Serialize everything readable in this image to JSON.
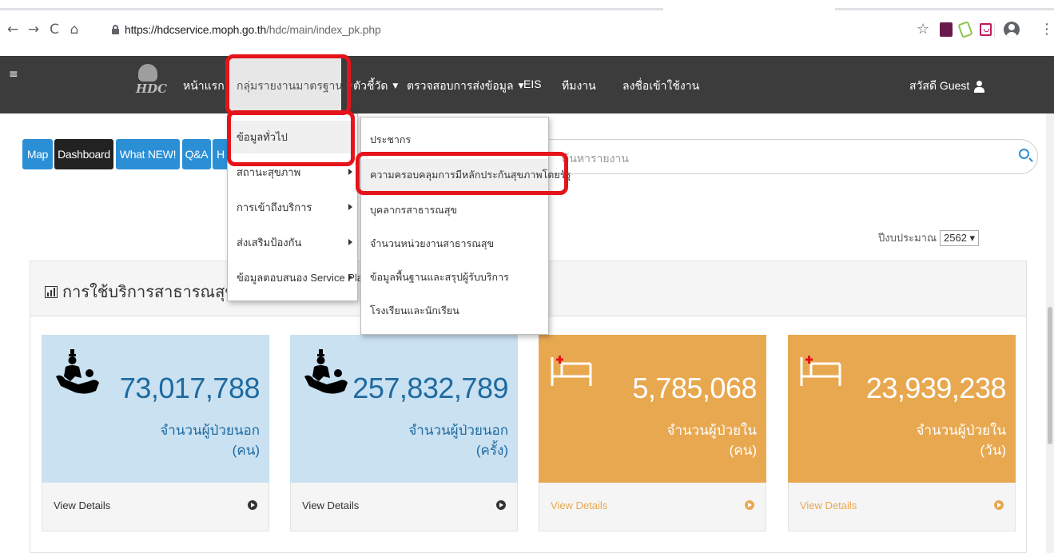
{
  "browser": {
    "url_host": "https://hdcservice.moph.go.th",
    "url_path": "/hdc/main/index_pk.php"
  },
  "navbar": {
    "home": "หน้าแรก",
    "standard_reports": "กลุ่มรายงานมาตรฐาน",
    "indicators": "ตัวชี้วัด",
    "data_check": "ตรวจสอบการส่งข้อมูล",
    "eis": "EIS",
    "team": "ทีมงาน",
    "register": "ลงชื่อเข้าใช้งาน",
    "greeting": "สวัสดี Guest"
  },
  "pills": [
    "Map",
    "Dashboard",
    "What NEW!",
    "Q&A",
    "H"
  ],
  "search": {
    "placeholder": "ค้นหารายงาน"
  },
  "fiscal_year": {
    "label": "ปีงบประมาณ",
    "value": "2562 ▾"
  },
  "panel": {
    "title": "การใช้บริการสาธารณสุข"
  },
  "menu1": {
    "items": [
      {
        "label": "ข้อมูลทั่วไป",
        "submenu": false
      },
      {
        "label": "สถานะสุขภาพ",
        "submenu": true
      },
      {
        "label": "การเข้าถึงบริการ",
        "submenu": true
      },
      {
        "label": "ส่งเสริมป้องกัน",
        "submenu": true
      },
      {
        "label": "ข้อมูลตอบสนอง Service Plan",
        "submenu": true
      }
    ]
  },
  "menu2": {
    "items": [
      {
        "label": "ประชากร"
      },
      {
        "label": "ความครอบคลุมการมีหลักประกันสุขภาพโดยรัฐ"
      },
      {
        "label": "บุคลากรสาธารณสุข"
      },
      {
        "label": "จำนวนหน่วยงานสาธารณสุข"
      },
      {
        "label": "ข้อมูลพื้นฐานและสรุปผู้รับบริการ"
      },
      {
        "label": "โรงเรียนและนักเรียน"
      }
    ]
  },
  "cards": [
    {
      "value": "73,017,788",
      "label1": "จำนวนผู้ป่วยนอก",
      "label2": "(คน)",
      "footer": "View Details",
      "icon": "doctor-patient-icon",
      "color": "#c9e1f1"
    },
    {
      "value": "257,832,789",
      "label1": "จำนวนผู้ป่วยนอก",
      "label2": "(ครั้ง)",
      "footer": "View Details",
      "icon": "doctor-patient-icon",
      "color": "#c9e1f1"
    },
    {
      "value": "5,785,068",
      "label1": "จำนวนผู้ป่วยใน",
      "label2": "(คน)",
      "footer": "View Details",
      "icon": "hospital-bed-icon",
      "color": "#e8a850"
    },
    {
      "value": "23,939,238",
      "label1": "จำนวนผู้ป่วยใน",
      "label2": "(วัน)",
      "footer": "View Details",
      "icon": "hospital-bed-icon",
      "color": "#e8a850"
    }
  ],
  "colors": {
    "navbar": "#3c3c3c",
    "accent": "#2b8fd6",
    "annotation": "#e5131a"
  }
}
